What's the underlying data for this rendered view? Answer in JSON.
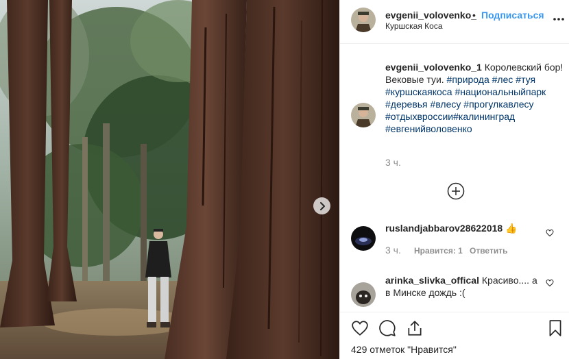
{
  "post": {
    "header": {
      "username": "evgenii_volovenko_",
      "separator": "•",
      "follow_label": "Подписаться",
      "location": "Куршская Коса",
      "more_icon": "more-horizontal-icon"
    },
    "caption": {
      "username": "evgenii_volovenko_1",
      "text": "Королевский бор! Вековые туи.",
      "hashtags": [
        "#природа",
        "#лес",
        "#туя",
        "#куршскаякоса",
        "#национальныйпарк",
        "#деревья",
        "#влесу",
        "#прогулкавлесу",
        "#отдыхвроссии",
        "#калининград",
        "#евгенийволовенко"
      ],
      "time": "3 ч."
    },
    "load_more_icon": "plus-circle-icon",
    "comments": [
      {
        "username": "ruslandjabbarov28622018",
        "emoji": "👍",
        "time": "3 ч.",
        "likes": "Нравится: 1",
        "reply": "Ответить"
      },
      {
        "username": "arinka_slivka_offical",
        "text": "Красиво.... а в Минске дождь :("
      }
    ],
    "actions": {
      "like_icon": "heart-icon",
      "comment_icon": "comment-icon",
      "share_icon": "share-icon",
      "save_icon": "bookmark-icon"
    },
    "likes_text": "429 отметок \"Нравится\"",
    "carousel_next_icon": "chevron-right-icon",
    "colors": {
      "link": "#3897f0",
      "hashtag": "#003569",
      "muted": "#8e8e8e",
      "text": "#262626",
      "border": "#efefef"
    }
  }
}
